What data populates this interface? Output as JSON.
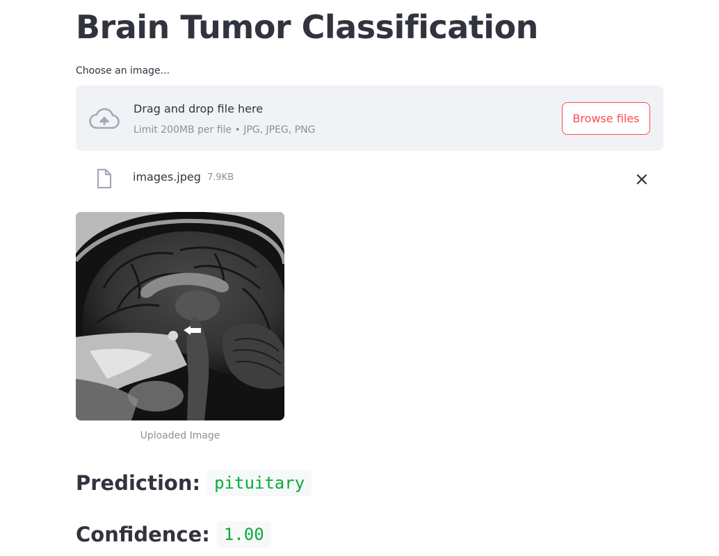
{
  "page": {
    "title": "Brain Tumor Classification"
  },
  "uploader": {
    "label": "Choose an image...",
    "drop_title": "Drag and drop file here",
    "drop_subtitle": "Limit 200MB per file • JPG, JPEG, PNG",
    "browse_label": "Browse files",
    "icons": {
      "upload": "cloud-upload-icon",
      "file": "file-icon",
      "remove": "close-icon"
    },
    "accent_color": "#ff4b4b"
  },
  "uploaded_file": {
    "name": "images.jpeg",
    "size": "7.9KB"
  },
  "image": {
    "caption": "Uploaded Image"
  },
  "results": {
    "prediction_label": "Prediction:",
    "prediction_value": "pituitary",
    "confidence_label": "Confidence:",
    "confidence_value": "1.00",
    "value_color": "#09ab3b"
  }
}
